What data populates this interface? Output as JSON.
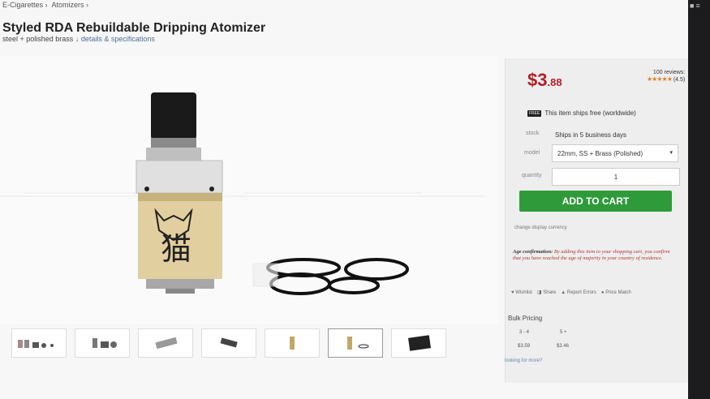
{
  "breadcrumb": {
    "item1": "E-Cigarettes ›",
    "item2": "Atomizers ›"
  },
  "product": {
    "title": "Styled RDA Rebuildable Dripping Atomizer",
    "subtitle_prefix": "steel + polished brass",
    "subtitle_link": "↓ details & specifications"
  },
  "price": {
    "dollars": "$3",
    "cents": ".88"
  },
  "reviews": {
    "count": "100 reviews:",
    "rating": "(4.5)",
    "stars": "★★★★★"
  },
  "shipping": {
    "badge": "FREE",
    "text": "This item ships free (worldwide)"
  },
  "stock": {
    "label": "stock",
    "value": "Ships in 5 business days"
  },
  "model": {
    "label": "model",
    "value": "22mm, SS + Brass (Polished)"
  },
  "quantity": {
    "label": "quantity",
    "value": "1"
  },
  "cart": {
    "label": "ADD TO CART"
  },
  "currency": {
    "label": "change display currency"
  },
  "age": {
    "title": "Age confirmation:",
    "text": "By adding this item to your shopping cart, you confirm that you have reached the age of majority in your country of residence."
  },
  "actions": {
    "wishlist": "Wishlist",
    "share": "Share",
    "report": "Report Errors",
    "price_match": "Price Match"
  },
  "bulk": {
    "title": "Bulk Pricing",
    "tiers": [
      {
        "qty": "3 - 4",
        "price": "$3.59"
      },
      {
        "qty": "5 +",
        "price": "$3.46"
      }
    ],
    "more": "looking for more?"
  },
  "colors": {
    "price": "#b21e2b",
    "cart": "#2f9a3a",
    "stars": "#d9822b"
  }
}
